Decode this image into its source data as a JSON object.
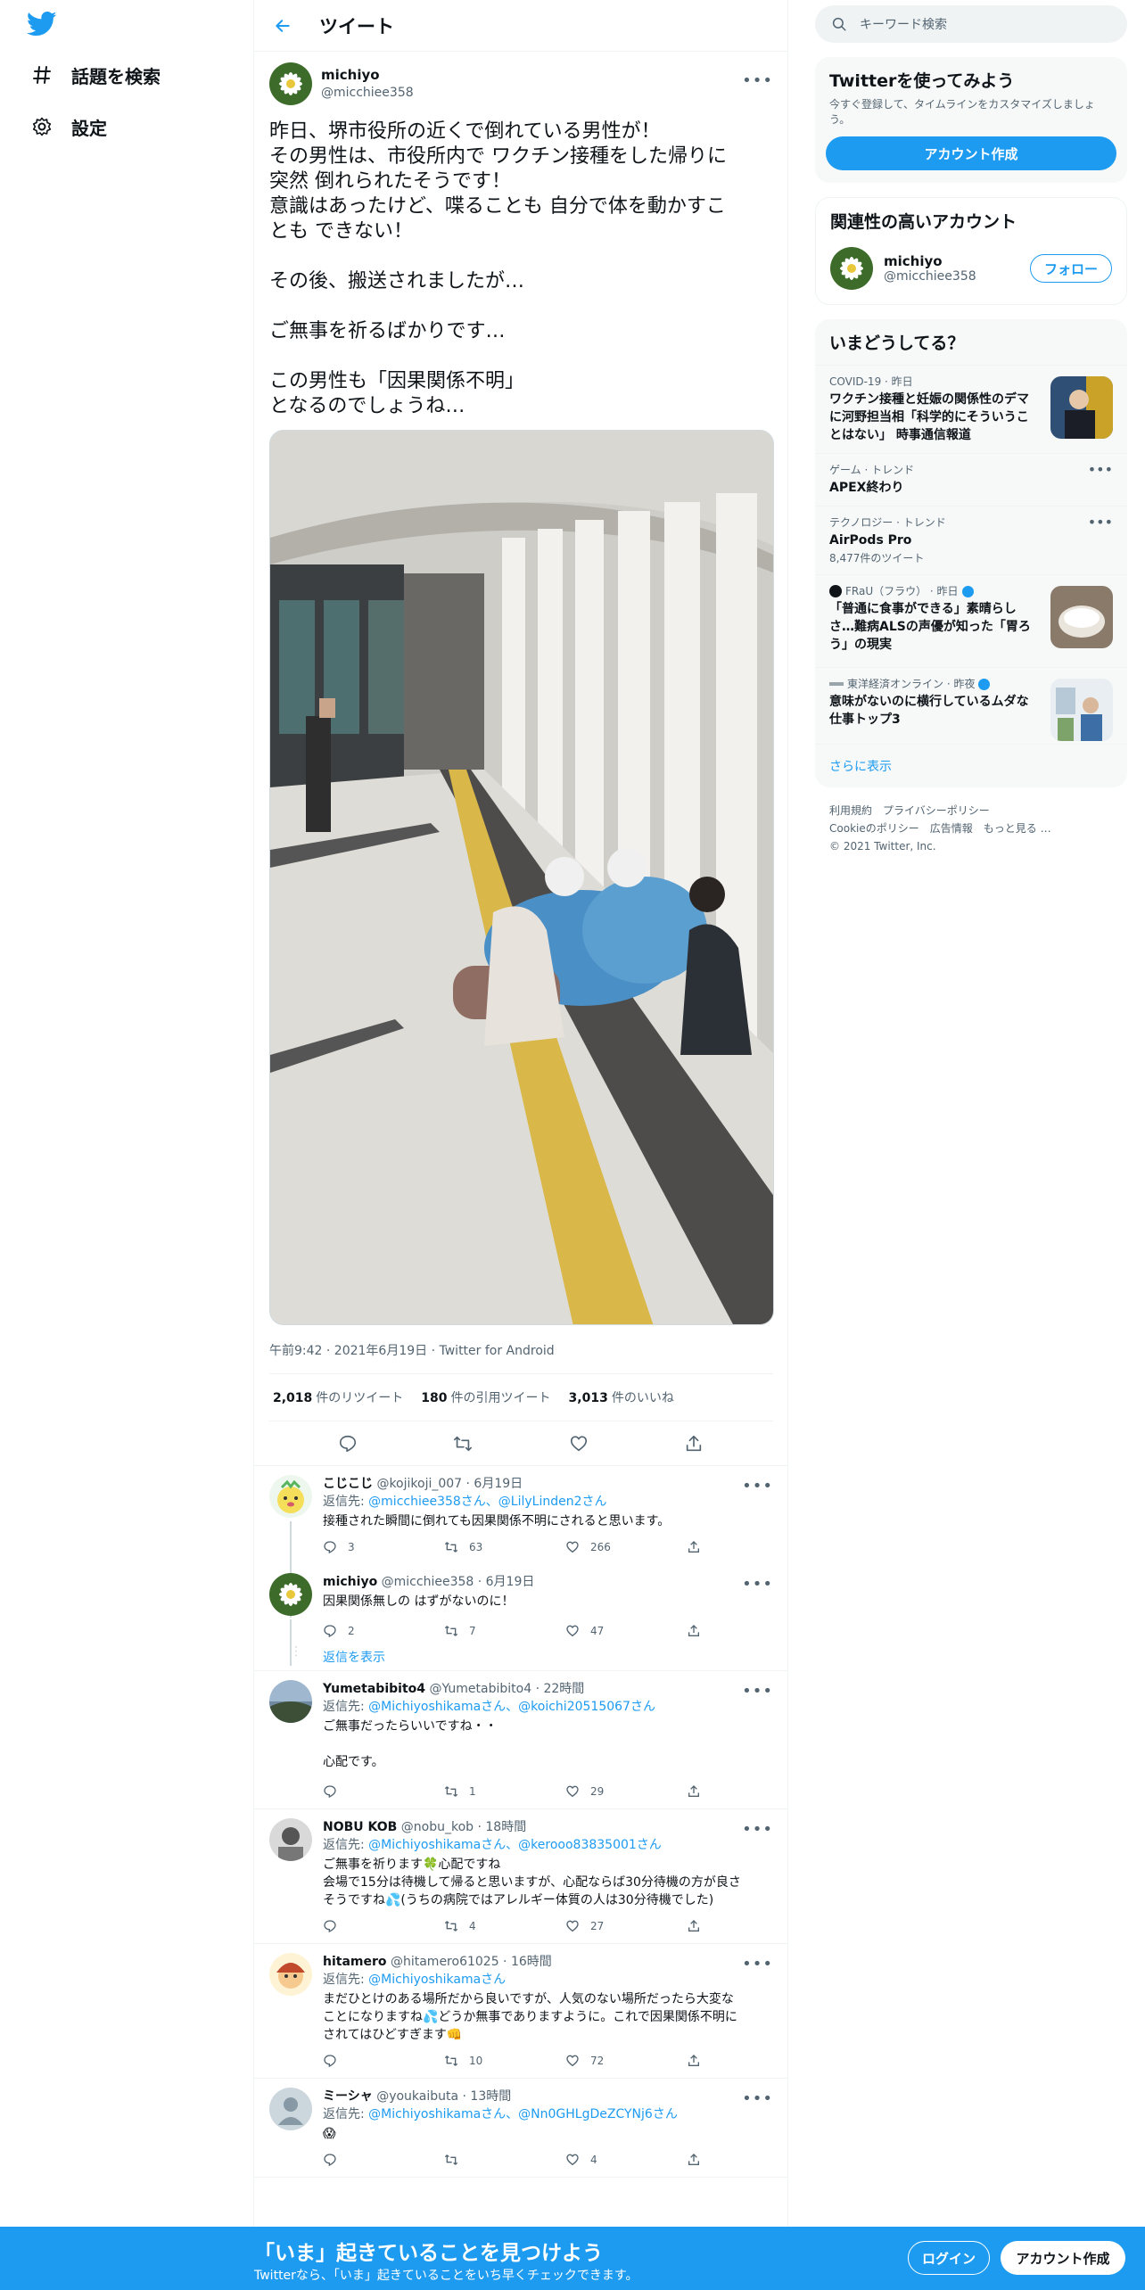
{
  "colors": {
    "accent": "#1d9bf0",
    "text": "#0f1419",
    "secondary": "#536471"
  },
  "nav": {
    "explore_label": "話題を検索",
    "settings_label": "設定"
  },
  "header": {
    "title": "ツイート"
  },
  "main_tweet": {
    "name": "michiyo",
    "handle": "@micchiee358",
    "text": "昨日、堺市役所の近くで倒れている男性が！\nその男性は、市役所内で ワクチン接種をした帰りに\n突然 倒れられたそうです！\n意識はあったけど、喋ることも 自分で体を動かすこ\nとも できない！\n\nその後、搬送されましたが…\n\nご無事を祈るばかりです…\n\nこの男性も「因果関係不明」\nとなるのでしょうね…",
    "meta": "午前9:42 · 2021年6月19日 · Twitter for Android",
    "retweets": "2,018",
    "retweets_label": "件のリツイート",
    "quotes": "180",
    "quotes_label": "件の引用ツイート",
    "likes": "3,013",
    "likes_label": "件のいいね"
  },
  "replies": [
    {
      "name": "こじこじ",
      "handle": "@kojikoji_007 · 6月19日",
      "to_prefix": "返信先: ",
      "to": "@micchiee358さん、@LilyLinden2さん",
      "text": "接種された瞬間に倒れても因果関係不明にされると思います。",
      "reply_count": "3",
      "retweet_count": "63",
      "like_count": "266"
    },
    {
      "name": "michiyo",
      "handle": "@micchiee358 · 6月19日",
      "text": "因果関係無しの はずがないのに！",
      "reply_count": "2",
      "retweet_count": "7",
      "like_count": "47"
    },
    {
      "name": "Yumetabibito4",
      "handle": "@Yumetabibito4 · 22時間",
      "to_prefix": "返信先: ",
      "to": "@Michiyoshikamaさん、@koichi20515067さん",
      "text": "ご無事だったらいいですね・・\n\n心配です。",
      "reply_count": "",
      "retweet_count": "1",
      "like_count": "29"
    },
    {
      "name": "NOBU KOB",
      "handle": "@nobu_kob · 18時間",
      "to_prefix": "返信先: ",
      "to": "@Michiyoshikamaさん、@kerooo83835001さん",
      "text": "ご無事を祈ります🍀心配ですね\n会場で15分は待機して帰ると思いますが、心配ならば30分待機の方が良さ\nそうですね💦(うちの病院ではアレルギー体質の人は30分待機でした)",
      "reply_count": "",
      "retweet_count": "4",
      "like_count": "27"
    },
    {
      "name": "hitamero",
      "handle": "@hitamero61025 · 16時間",
      "to_prefix": "返信先: ",
      "to": "@Michiyoshikamaさん",
      "text": "まだひとけのある場所だから良いですが、人気のない場所だったら大変な\nことになりますね💦どうか無事でありますように。これで因果関係不明に\nされてはひどすぎます👊",
      "reply_count": "",
      "retweet_count": "10",
      "like_count": "72"
    },
    {
      "name": "ミーシャ",
      "handle": "@youkaibuta · 13時間",
      "to_prefix": "返信先: ",
      "to": "@Michiyoshikamaさん、@Nn0GHLgDeZCYNj6さん",
      "text": "😱",
      "reply_count": "",
      "retweet_count": "",
      "like_count": "4"
    }
  ],
  "show_replies": "返信を表示",
  "sidebar": {
    "search_placeholder": "キーワード検索",
    "signup_title": "Twitterを使ってみよう",
    "signup_desc": "今すぐ登録して、タイムラインをカスタマイズしましょう。",
    "signup_button": "アカウント作成",
    "related_title": "関連性の高いアカウント",
    "related_name": "michiyo",
    "related_handle": "@micchiee358",
    "follow_button": "フォロー",
    "trends_title": "いまどうしてる？",
    "trends": [
      {
        "category": "COVID-19 · 昨日",
        "title": "ワクチン接種と妊娠の関係性のデマに河野担当相「科学的にそういうことはない」 時事通信報道",
        "sub": ""
      },
      {
        "category": "ゲーム · トレンド",
        "title": "APEX終わり",
        "sub": ""
      },
      {
        "category": "テクノロジー · トレンド",
        "title": "AirPods Pro",
        "sub": "8,477件のツイート"
      },
      {
        "category": "FRaU（フラウ） · 昨日",
        "title": "「普通に食事ができる」素晴らしさ…難病ALSの声優が知った「胃ろう」の現実",
        "sub": ""
      },
      {
        "category": "東洋経済オンライン · 昨夜",
        "title": "意味がないのに横行しているムダな仕事トップ3",
        "sub": ""
      }
    ],
    "show_more": "さらに表示",
    "footer_line1": [
      "利用規約",
      "プライバシーポリシー"
    ],
    "footer_line2": [
      "Cookieのポリシー",
      "広告情報",
      "もっと見る …"
    ],
    "copyright": "© 2021 Twitter, Inc."
  },
  "bottom_bar": {
    "title": "「いま」起きていることを見つけよう",
    "subtitle": "Twitterなら、「いま」起きていることをいち早くチェックできます。",
    "login": "ログイン",
    "signup": "アカウント作成"
  }
}
